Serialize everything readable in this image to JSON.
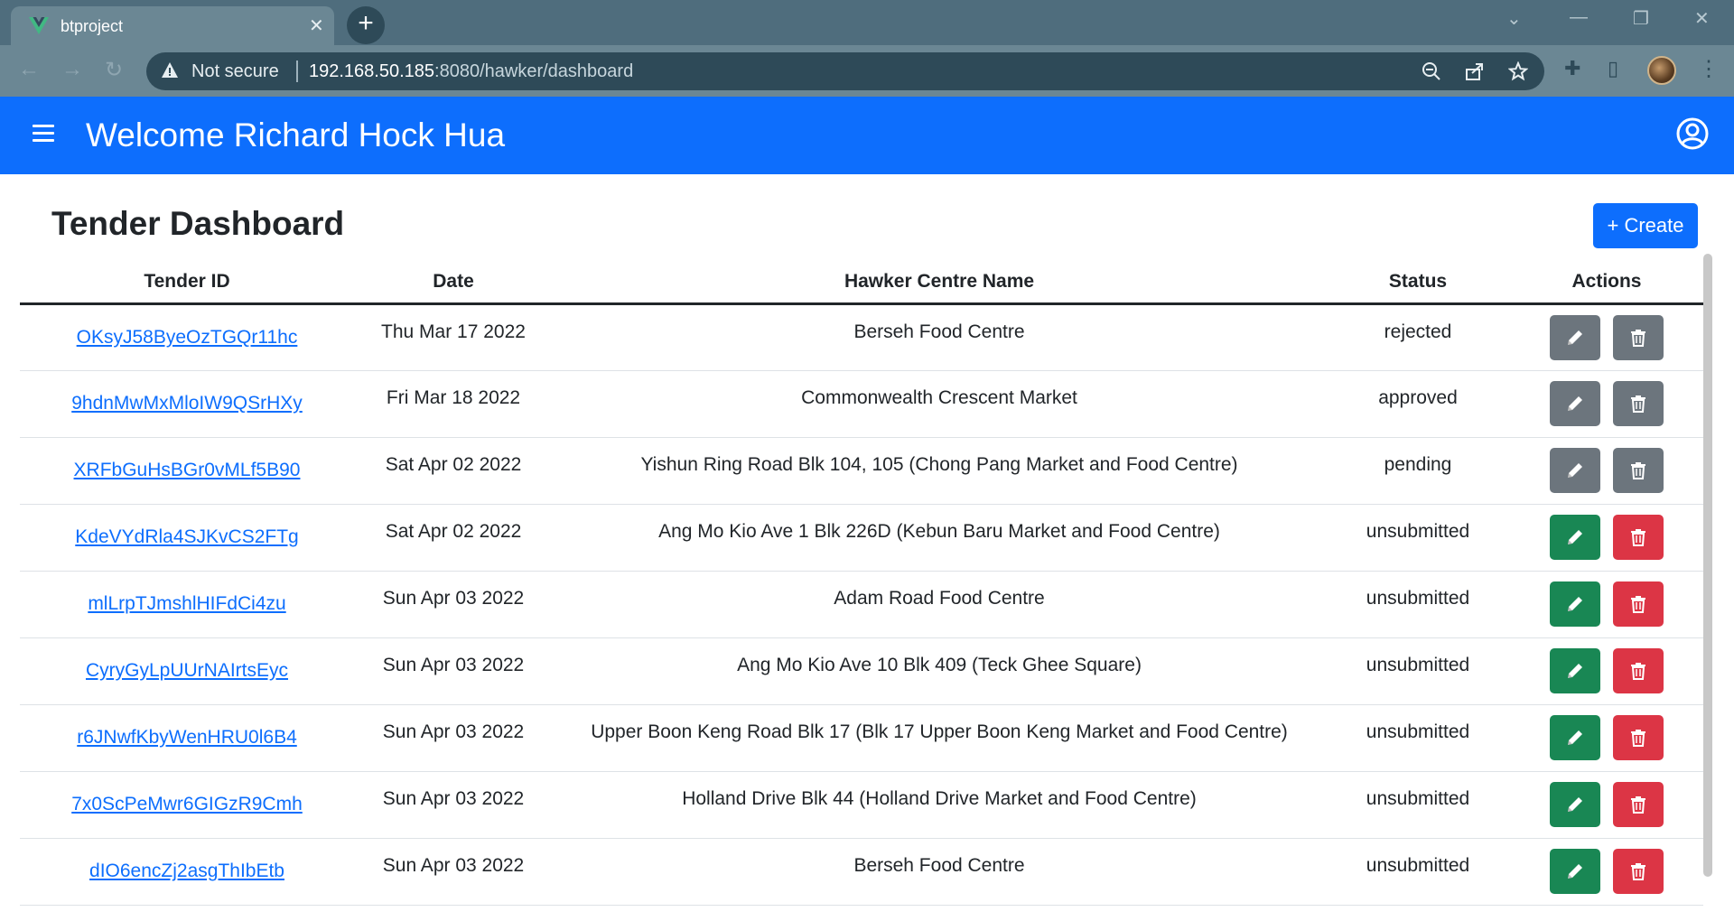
{
  "browser": {
    "tab_title": "btproject",
    "tab_close": "✕",
    "new_tab": "+",
    "not_secure": "Not secure",
    "url_host": "192.168.50.185",
    "url_path": ":8080/hawker/dashboard"
  },
  "header": {
    "welcome": "Welcome Richard Hock Hua"
  },
  "page": {
    "title": "Tender Dashboard",
    "create_label": "+ Create"
  },
  "table": {
    "headers": [
      "Tender ID",
      "Date",
      "Hawker Centre Name",
      "Status",
      "Actions"
    ],
    "rows": [
      {
        "id": "OKsyJ58ByeOzTGQr11hc",
        "date": "Thu Mar 17 2022",
        "name": "Berseh Food Centre",
        "status": "rejected"
      },
      {
        "id": "9hdnMwMxMloIW9QSrHXy",
        "date": "Fri Mar 18 2022",
        "name": "Commonwealth Crescent Market",
        "status": "approved"
      },
      {
        "id": "XRFbGuHsBGr0vMLf5B90",
        "date": "Sat Apr 02 2022",
        "name": "Yishun Ring Road Blk 104, 105 (Chong Pang Market and Food Centre)",
        "status": "pending"
      },
      {
        "id": "KdeVYdRla4SJKvCS2FTg",
        "date": "Sat Apr 02 2022",
        "name": "Ang Mo Kio Ave 1 Blk 226D (Kebun Baru Market and Food Centre)",
        "status": "unsubmitted"
      },
      {
        "id": "mlLrpTJmshlHIFdCi4zu",
        "date": "Sun Apr 03 2022",
        "name": "Adam Road Food Centre",
        "status": "unsubmitted"
      },
      {
        "id": "CyryGyLpUUrNAIrtsEyc",
        "date": "Sun Apr 03 2022",
        "name": "Ang Mo Kio Ave 10 Blk 409 (Teck Ghee Square)",
        "status": "unsubmitted"
      },
      {
        "id": "r6JNwfKbyWenHRU0l6B4",
        "date": "Sun Apr 03 2022",
        "name": "Upper Boon Keng Road Blk 17 (Blk 17 Upper Boon Keng Market and Food Centre)",
        "status": "unsubmitted"
      },
      {
        "id": "7x0ScPeMwr6GIGzR9Cmh",
        "date": "Sun Apr 03 2022",
        "name": "Holland Drive Blk 44 (Holland Drive Market and Food Centre)",
        "status": "unsubmitted"
      },
      {
        "id": "dIO6encZj2asgThIbEtb",
        "date": "Sun Apr 03 2022",
        "name": "Berseh Food Centre",
        "status": "unsubmitted"
      }
    ]
  },
  "icons": {
    "edit": "pencil-icon",
    "delete": "trash-icon",
    "menu": "hamburger-icon",
    "user": "user-circle-icon"
  },
  "colors": {
    "primary": "#0d6efd",
    "success": "#198754",
    "danger": "#dc3545",
    "warning": "#ffc107",
    "secondary": "#6c757d"
  }
}
